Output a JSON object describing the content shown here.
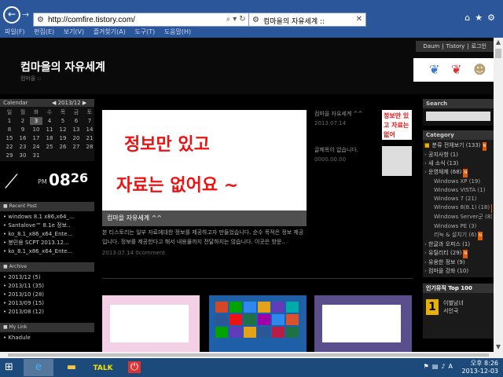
{
  "browser": {
    "back_icon": "back-arrow-icon",
    "url_prefix": "http://",
    "url": "comfire.tistory.com/",
    "tab_title": "컴마을의 자유세계 ::",
    "menu": [
      "파일(F)",
      "편집(E)",
      "보기(V)",
      "즐겨찾기(A)",
      "도구(T)",
      "도움말(H)"
    ]
  },
  "header": {
    "title": "컴마을의 자유세계",
    "subtitle": "컴마을 ::",
    "nav": [
      "Daum",
      "Tistory",
      "로그인"
    ]
  },
  "calendar": {
    "label": "Calendar",
    "month": "◀ 2013/12 ▶",
    "weekdays": [
      "일",
      "월",
      "화",
      "수",
      "목",
      "금",
      "토"
    ],
    "days": [
      "1",
      "2",
      "3",
      "4",
      "5",
      "6",
      "7",
      "8",
      "9",
      "10",
      "11",
      "12",
      "13",
      "14",
      "15",
      "16",
      "17",
      "18",
      "19",
      "20",
      "21",
      "22",
      "23",
      "24",
      "25",
      "26",
      "27",
      "28",
      "29",
      "30",
      "31"
    ],
    "today": "3"
  },
  "clock": {
    "ampm": "PM",
    "hour": "08",
    "minute": "26"
  },
  "recent_post": {
    "label": "Recent Post",
    "items": [
      "windows 8.1 x86,x64_...",
      "Santalove™ 8.1e 정보..",
      "ko_8.1_x86_x64_Ente...",
      "붕민용 SCPT 2013.12...",
      "ko_8.1_x86_x64_Ente..."
    ]
  },
  "archive": {
    "label": "Archive",
    "items": [
      "2013/12 (5)",
      "2013/11 (35)",
      "2013/10 (28)",
      "2013/09 (15)",
      "2013/08 (12)"
    ]
  },
  "mylink": {
    "label": "My Link",
    "first": "Khadule"
  },
  "main": {
    "hero_line1": "정보만 있고",
    "hero_line2": "자료는 없어요 ~",
    "hero_caption": "컴마을 자유세계 ^^",
    "excerpt": "본 티스토리는 일부 자료에대한 정보를 제공하고자 만들었습니다. 순수 목적은 정보 제공입니다. 정보를 제공한다고 해서 내용물까지 전달하지는 않습니다. 이곳은 방문..",
    "excerpt_meta": "2013.07.14  0comment",
    "side_post1_title": "컴마을 자유세계 ^^",
    "side_post1_date": "2013.07.14",
    "side_post2_title": "글제목이 없습니다.",
    "side_post2_date": "0000.00.00",
    "thumb_text": "정보만 있고 자료는 없어"
  },
  "right": {
    "search_label": "Search",
    "category_label": "Category",
    "categories": [
      {
        "label": "분류 전체보기 (133)",
        "kind": "top",
        "new": true
      },
      {
        "label": "공지사항 (1)",
        "kind": "item",
        "new": false
      },
      {
        "label": "새 소식 (13)",
        "kind": "item",
        "new": false
      },
      {
        "label": "운영체제 (68)",
        "kind": "item",
        "new": true
      },
      {
        "label": "Windows XP (19)",
        "kind": "sub",
        "new": false
      },
      {
        "label": "Windows VISTA (1)",
        "kind": "sub",
        "new": false
      },
      {
        "label": "Windows 7 (21)",
        "kind": "sub",
        "new": false
      },
      {
        "label": "Windows 8(8.1) (18)",
        "kind": "sub",
        "new": true
      },
      {
        "label": "Windows Server군 (8)",
        "kind": "sub",
        "new": true
      },
      {
        "label": "Windows PE (3)",
        "kind": "sub",
        "new": false
      },
      {
        "label": "리눅 & 설치기 (6)",
        "kind": "sub",
        "new": true
      },
      {
        "label": "한글과 오피스 (1)",
        "kind": "item",
        "new": false
      },
      {
        "label": "유틸리티 (29)",
        "kind": "item",
        "new": true
      },
      {
        "label": "유용한 정보 (9)",
        "kind": "item",
        "new": false
      },
      {
        "label": "컴마을 강좌 (10)",
        "kind": "item",
        "new": false
      }
    ],
    "top100_label": "인기뮤직 Top 100",
    "top100_rank": "1",
    "top100_title": "이별남녀",
    "top100_artist": "서인국"
  },
  "taskbar": {
    "time": "오후 8:26",
    "date": "2013-12-03",
    "ime": "A"
  },
  "colors": {
    "chrome": "#2b579a",
    "taskbar": "#1c4a7a",
    "accent_red": "#ee1111",
    "badge": "#e05a00"
  }
}
